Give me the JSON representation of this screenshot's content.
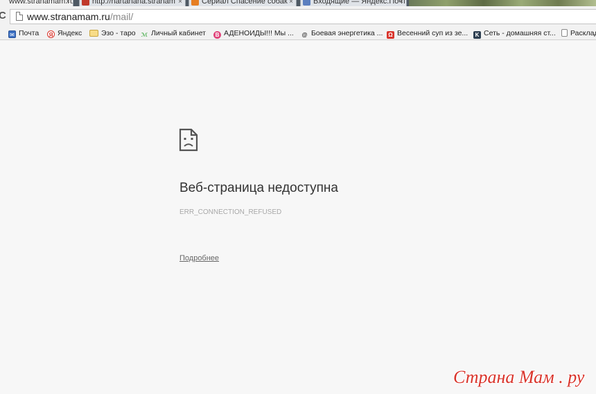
{
  "tabs": [
    {
      "label": "www.stranamam.ru/n",
      "close": "×",
      "active": true
    },
    {
      "label": "http://nartanana.stranam",
      "close": "×",
      "active": false,
      "color": "#c0392b"
    },
    {
      "label": "Сериал Спасение собак",
      "close": "×",
      "active": false,
      "color": "#e67e22"
    },
    {
      "label": "Входящие — Яндекс.Почта",
      "close": "×",
      "active": false,
      "color": "#5b7fbf"
    }
  ],
  "toolbar": {
    "reload_icon": "reload-icon",
    "reload_glyph": "C",
    "url_host": "www.stranamam.ru",
    "url_path": "/mail/"
  },
  "bookmarks": [
    {
      "label": "Почта",
      "icon": "mail-icon",
      "glyph": "✉",
      "color": "#3b6fc2"
    },
    {
      "label": "Яндекс",
      "icon": "yandex-icon",
      "glyph": "Я",
      "color": "#ffffff"
    },
    {
      "label": "Эзо - таро",
      "icon": "folder-icon",
      "glyph": "",
      "color": "#f3d27a"
    },
    {
      "label": "Личный кабинет",
      "icon": "feather-icon",
      "glyph": "ℳ",
      "color": "#f2f2f2"
    },
    {
      "label": "АДЕНОИДЫ!!! Мы ...",
      "icon": "b-icon",
      "glyph": "B",
      "color": "#e0457b"
    },
    {
      "label": "Боевая энергетика ...",
      "icon": "spiral-icon",
      "glyph": "@",
      "color": "#f2f2f2"
    },
    {
      "label": "Весенний суп из зе...",
      "icon": "soup-icon",
      "glyph": "Ω",
      "color": "#d9342b"
    },
    {
      "label": "Сеть - домашняя ст...",
      "icon": "k-icon",
      "glyph": "K",
      "color": "#2c3e50"
    },
    {
      "label": "Расклад",
      "icon": "page-icon",
      "glyph": "",
      "color": "#ffffff"
    }
  ],
  "error": {
    "icon": "sad-page-icon",
    "title": "Веб-страница недоступна",
    "code": "ERR_CONNECTION_REFUSED",
    "details_link": "Подробнее"
  },
  "watermark": "Страна Мам . ру"
}
